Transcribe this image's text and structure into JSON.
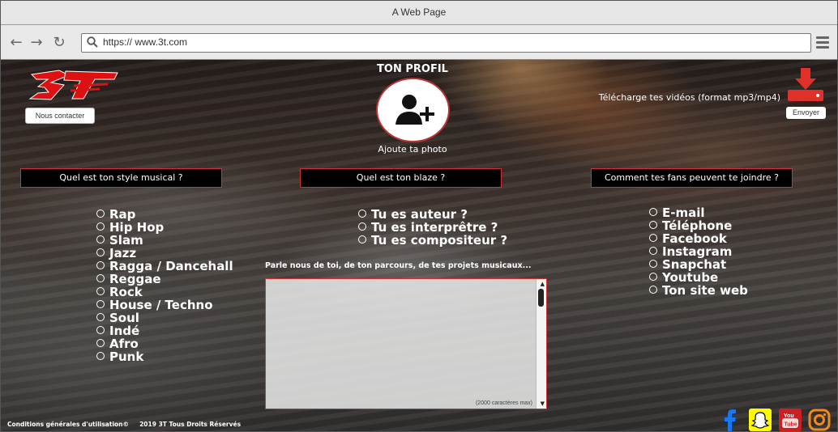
{
  "browser": {
    "title": "A Web Page",
    "url": "https:// www.3t.com"
  },
  "header": {
    "logo_text": "3T",
    "contact_label": "Nous contacter",
    "profile_title": "TON PROFIL",
    "photo_caption": "Ajoute ta photo",
    "upload_text": "Télécharge tes vidéos (format mp3/mp4)",
    "send_label": "Envoyer"
  },
  "sections": {
    "style": {
      "heading": "Quel est ton style musical ?",
      "options": [
        "Rap",
        "Hip Hop",
        "Slam",
        "Jazz",
        "Ragga / Dancehall",
        "Reggae",
        "Rock",
        "House / Techno",
        "Soul",
        "Indé",
        "Afro",
        "Punk"
      ]
    },
    "blaze": {
      "heading": "Quel est ton blaze ?",
      "options": [
        "Tu es auteur ?",
        "Tu es interprêtre ?",
        "Tu es compositeur ?"
      ]
    },
    "contact": {
      "heading": "Comment tes fans peuvent te joindre ?",
      "options": [
        "E-mail",
        "Téléphone",
        "Facebook",
        "Instagram",
        "Snapchat",
        "Youtube",
        "Ton site web"
      ]
    }
  },
  "bio": {
    "prompt": "Parle nous de toi, de ton parcours, de tes projets musicaux...",
    "hint": "(2000 caractères max)"
  },
  "footer": {
    "terms": "Conditions générales d'utilisation©",
    "copyright": "2019 3T Tous Droits Réservés"
  },
  "social_icons": [
    "facebook-icon",
    "snapchat-icon",
    "youtube-icon",
    "instagram-icon"
  ],
  "colors": {
    "accent_red": "#cc2222",
    "facebook": "#1877f2",
    "snapchat": "#fffc00",
    "youtube": "#cc1f1f",
    "instagram": "#f08a1c"
  }
}
